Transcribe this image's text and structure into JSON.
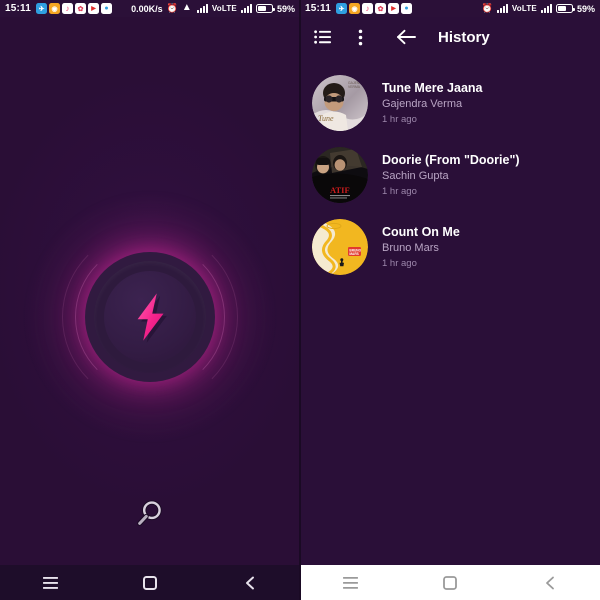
{
  "theme": {
    "bg_purple": "#2a0f38",
    "statusbar_bg": "#2b1038",
    "accent_pink": "#ec2ea6",
    "bolt_pink": "#f8308f",
    "navbar_dark": "#1e0d2a",
    "navbar_light": "#ffffff",
    "text_primary": "#ffffff",
    "text_secondary": "#b9a5c4",
    "text_tertiary": "#9c87ab"
  },
  "status_bar_left": {
    "clock": "15:11",
    "network_speed": "0.00K/s",
    "notification_icons": [
      "telegram-icon",
      "orange-app-icon",
      "music-app-icon",
      "photo-app-icon",
      "video-app-icon",
      "messenger-icon"
    ],
    "alarm_icon": "alarm-icon",
    "wifi_icon": "wifi-icon",
    "signal_icon": "signal-bars-icon",
    "volte_label": "VoLTE",
    "signal2_icon": "signal-bars-icon",
    "battery_icon": "battery-icon",
    "battery_percent": "59%",
    "battery_level": 59
  },
  "status_bar_right": {
    "clock": "15:11",
    "notification_icons": [
      "telegram-icon",
      "orange-app-icon",
      "music-app-icon",
      "photo-app-icon",
      "video-app-icon",
      "messenger-icon"
    ],
    "alarm_icon": "alarm-icon",
    "signal_icon": "signal-bars-icon",
    "volte_label": "VoLTE",
    "signal2_icon": "signal-bars-icon",
    "battery_icon": "battery-icon",
    "battery_percent": "59%",
    "battery_level": 59
  },
  "left_screen": {
    "name": "recognize-screen",
    "bolt_button": {
      "icon": "lightning-bolt-icon",
      "label": ""
    },
    "search_button": {
      "icon": "search-icon",
      "label": ""
    },
    "nav": {
      "recents": "recents-icon",
      "home": "home-icon",
      "back": "back-icon"
    }
  },
  "right_screen": {
    "appbar": {
      "list_icon": "list-view-icon",
      "overflow_icon": "more-vert-icon",
      "back_icon": "arrow-back-icon",
      "title": "History"
    },
    "history": [
      {
        "title": "Tune Mere Jaana",
        "artist": "Gajendra Verma",
        "time": "1 hr ago",
        "art_name": "album-art-tune-mere-jaana"
      },
      {
        "title": "Doorie (From \"Doorie\")",
        "artist": "Sachin Gupta",
        "time": "1 hr ago",
        "art_name": "album-art-doorie"
      },
      {
        "title": "Count On Me",
        "artist": "Bruno Mars",
        "time": "1 hr ago",
        "art_name": "album-art-count-on-me"
      }
    ],
    "nav": {
      "recents": "recents-icon",
      "home": "home-icon",
      "back": "back-icon"
    }
  }
}
